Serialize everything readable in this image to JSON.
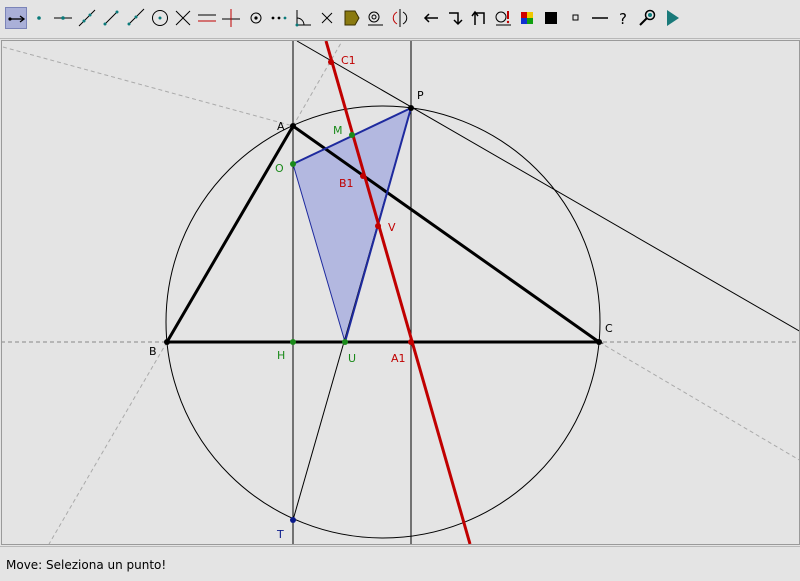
{
  "toolbar": {
    "tools": [
      {
        "name": "move-tool-icon",
        "active": true
      },
      {
        "name": "point-tool-icon"
      },
      {
        "name": "point-on-line-tool-icon"
      },
      {
        "name": "line-tool-icon"
      },
      {
        "name": "segment-tool-icon"
      },
      {
        "name": "ray-tool-icon"
      },
      {
        "name": "circle-tool-icon"
      },
      {
        "name": "intersect-tool-icon"
      },
      {
        "name": "parallel-line-tool-icon"
      },
      {
        "name": "perpendicular-line-tool-icon"
      },
      {
        "name": "midpoint-tool-icon"
      },
      {
        "name": "dotted-line-tool-icon"
      },
      {
        "name": "angle-tool-icon"
      },
      {
        "name": "delete-tool-icon"
      },
      {
        "name": "polygon-tool-icon"
      },
      {
        "name": "locus-tool-icon"
      },
      {
        "name": "reflect-tool-icon"
      },
      {
        "name": "undo-arrow-icon"
      },
      {
        "name": "redo-arrow-icon"
      },
      {
        "name": "rotate-arrow-icon"
      },
      {
        "name": "measure-tool-icon"
      },
      {
        "name": "color-palette-icon"
      },
      {
        "name": "fill-square-icon"
      },
      {
        "name": "small-square-icon"
      },
      {
        "name": "line-style-icon"
      },
      {
        "name": "help-icon"
      },
      {
        "name": "zoom-tool-icon"
      },
      {
        "name": "play-icon"
      }
    ]
  },
  "canvas": {
    "labels": {
      "C1": "C1",
      "P": "P",
      "A": "A",
      "M": "M",
      "O": "O",
      "B1": "B1",
      "V": "V",
      "B": "B",
      "H": "H",
      "U": "U",
      "A1": "A1",
      "C": "C",
      "T": "T"
    }
  },
  "status": {
    "text": "Move: Seleziona un punto!"
  },
  "colors": {
    "background": "#e4e4e4",
    "triangle": "#000000",
    "red_line": "#c00000",
    "fill": "#b3b8e0",
    "blue": "#1e2a9e",
    "green_point": "#1a8a1a",
    "red_point": "#c00000",
    "navy_point": "#0a1a8a"
  }
}
